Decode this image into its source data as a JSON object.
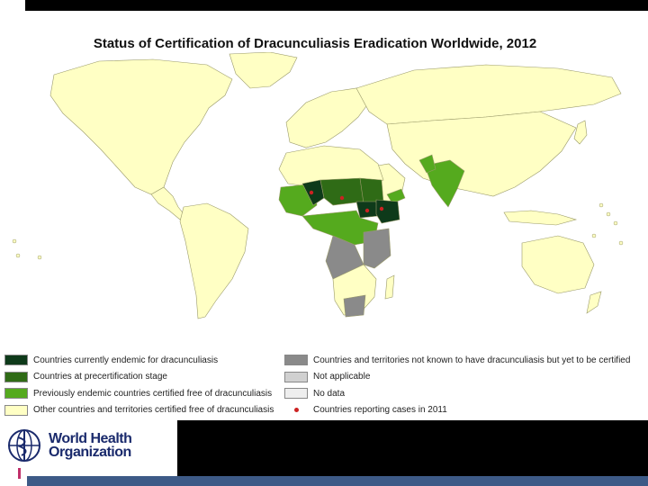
{
  "title": "Status of Certification of Dracunculiasis Eradication Worldwide, 2012",
  "legend": {
    "left": [
      {
        "label": "Countries currently endemic for dracunculiasis",
        "color": "#0e3a1a"
      },
      {
        "label": "Countries at precertification stage",
        "color": "#2f6b16"
      },
      {
        "label": "Previously endemic countries certified free of dracunculiasis",
        "color": "#55aa1e"
      },
      {
        "label": "Other countries and territories certified free of dracunculiasis",
        "color": "#ffffc4"
      }
    ],
    "right": [
      {
        "label": "Countries and territories not known to have dracunculiasis but yet to be certified",
        "color": "#8a8a8a"
      },
      {
        "label": "Not applicable",
        "color": "#d0d0d0"
      },
      {
        "label": "No data",
        "color": "#eeeeee"
      },
      {
        "label": "Countries reporting cases in 2011",
        "color": "#cc2222",
        "marker": "dot"
      }
    ]
  },
  "organization": {
    "line1": "World Health",
    "line2": "Organization"
  },
  "colors": {
    "land_default": "#ffffc4",
    "border": "#9a9a6a",
    "ocean": "#ffffff"
  }
}
